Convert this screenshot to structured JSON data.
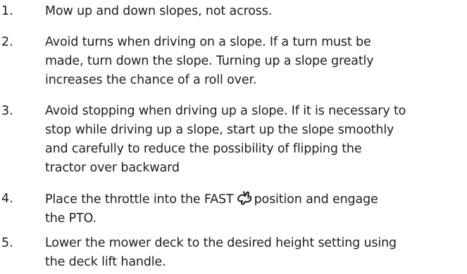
{
  "steps": [
    {
      "number": "1.",
      "lines": [
        "Mow up and down slopes, not across."
      ]
    },
    {
      "number": "2.",
      "lines": [
        "Avoid turns when driving on a slope. If a turn must be",
        "made, turn down the slope. Turning up a slope greatly",
        "increases the chance of a roll over."
      ]
    },
    {
      "number": "3.",
      "lines": [
        "Avoid stopping when driving up a slope. If it is necessary to",
        "stop while driving up a slope, start up the slope smoothly",
        "and carefully to reduce the possibility of flipping the",
        "tractor over backward"
      ]
    },
    {
      "number": "4.",
      "line1_before": "Place the throttle into the FAST",
      "icon": "rabbit-fast-icon",
      "line1_after": "position and engage",
      "line2": "the PTO."
    },
    {
      "number": "5.",
      "lines": [
        "Lower the mower deck to the desired height setting using",
        "the deck lift handle."
      ]
    }
  ]
}
